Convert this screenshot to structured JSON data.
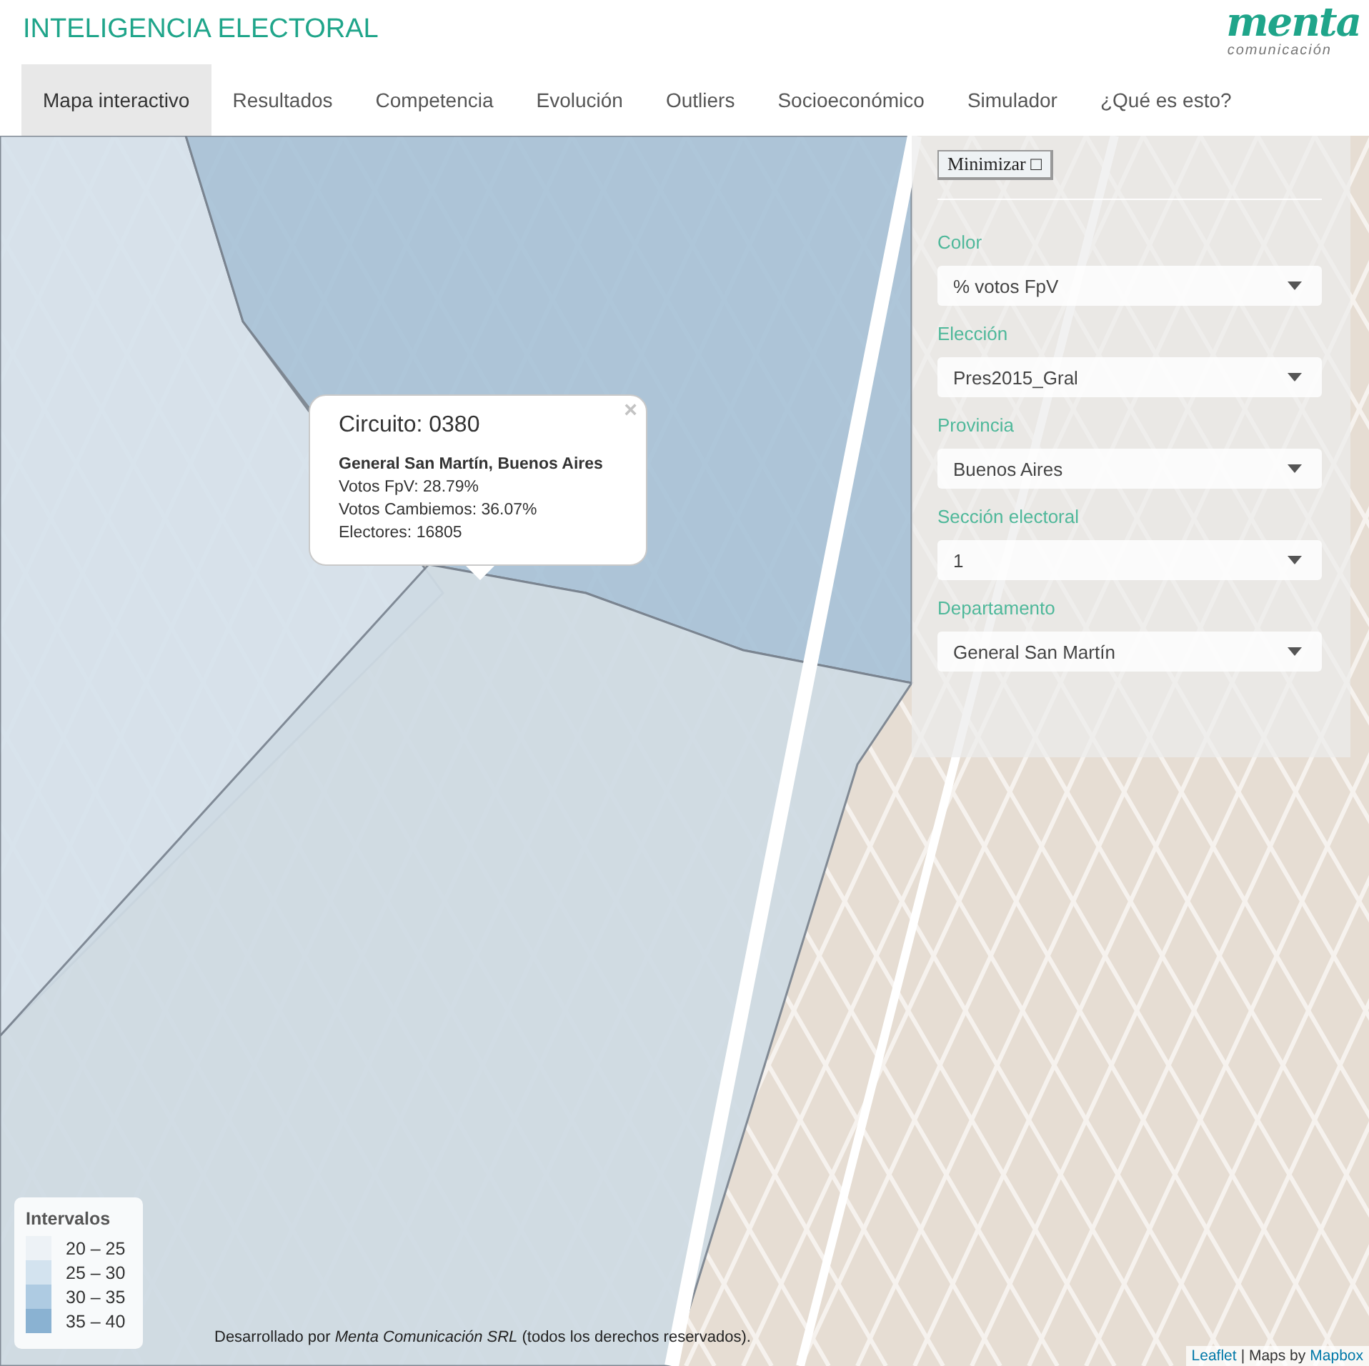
{
  "header": {
    "title": "INTELIGENCIA ELECTORAL",
    "logo": {
      "name": "menta",
      "tagline": "comunicación"
    }
  },
  "tabs": [
    {
      "label": "Mapa interactivo",
      "selected": true
    },
    {
      "label": "Resultados",
      "selected": false
    },
    {
      "label": "Competencia",
      "selected": false
    },
    {
      "label": "Evolución",
      "selected": false
    },
    {
      "label": "Outliers",
      "selected": false
    },
    {
      "label": "Socioeconómico",
      "selected": false
    },
    {
      "label": "Simulador",
      "selected": false
    },
    {
      "label": "¿Qué es esto?",
      "selected": false
    }
  ],
  "panel": {
    "minimize_button": "Minimizar □",
    "filters": [
      {
        "label": "Color",
        "value": "% votos FpV"
      },
      {
        "label": "Elección",
        "value": "Pres2015_Gral"
      },
      {
        "label": "Provincia",
        "value": "Buenos Aires"
      },
      {
        "label": "Sección electoral",
        "value": "1"
      },
      {
        "label": "Departamento",
        "value": "General San Martín"
      }
    ]
  },
  "popup": {
    "title": "Circuito: 0380",
    "close": "×",
    "place": "General San Martín, Buenos Aires",
    "lines": [
      "Votos FpV: 28.79%",
      "Votos Cambiemos: 36.07%",
      "Electores: 16805"
    ]
  },
  "legend": {
    "title": "Intervalos",
    "items": [
      {
        "label": "20 – 25",
        "color": "#edf2f6"
      },
      {
        "label": "25 – 30",
        "color": "#d3e3ef"
      },
      {
        "label": "30 – 35",
        "color": "#aecbe2"
      },
      {
        "label": "35 – 40",
        "color": "#8ab2d2"
      }
    ]
  },
  "footer": {
    "credit": "Desarrollado por *Menta Comunicación SRL* (todos los derechos reservados).",
    "attribution": {
      "leaflet": "Leaflet",
      "separator": "| Maps by",
      "provider": "Mapbox"
    }
  }
}
